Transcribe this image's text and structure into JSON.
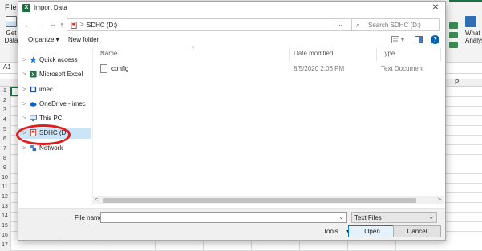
{
  "excel": {
    "file_tab": "File",
    "get_data_label": "Get Data",
    "right_ribbon_label": "What Analys",
    "namebox": "A1",
    "column_p": "P",
    "row_numbers": [
      "1",
      "2",
      "3",
      "4",
      "5",
      "6",
      "7",
      "8",
      "9",
      "10",
      "11",
      "12",
      "13",
      "14",
      "15",
      "16",
      "17"
    ]
  },
  "dialog": {
    "title": "Import Data",
    "close_glyph": "✕",
    "address": {
      "separator": ">",
      "path": "SDHC (D:)",
      "dropdown_glyph": "⌄",
      "refresh_glyph": "↻"
    },
    "search": {
      "icon_glyph": "⌕",
      "placeholder": "Search SDHC (D:)"
    },
    "toolbar": {
      "organize": "Organize ▾",
      "new_folder": "New folder",
      "help_glyph": "?"
    },
    "nav": {
      "back_glyph": "←",
      "forward_glyph": "→",
      "history_glyph": "⌄",
      "up_glyph": "↑",
      "items": [
        {
          "label": "Quick access",
          "icon": "star-icon",
          "chevron": ">"
        },
        {
          "label": "Microsoft Excel",
          "icon": "excel-icon",
          "chevron": ">"
        },
        {
          "label": "imec",
          "icon": "folder-icon",
          "chevron": ">"
        },
        {
          "label": "OneDrive - imec",
          "icon": "cloud-icon",
          "chevron": ">"
        },
        {
          "label": "This PC",
          "icon": "pc-icon",
          "chevron": ">"
        },
        {
          "label": "SDHC (D:)",
          "icon": "drive-icon",
          "chevron": ">"
        },
        {
          "label": "Network",
          "icon": "network-icon",
          "chevron": ">"
        }
      ],
      "selected_index": 5
    },
    "columns": {
      "name": "Name",
      "date_modified": "Date modified",
      "type": "Type"
    },
    "files": [
      {
        "name": "config",
        "date_modified": "8/5/2020 2:06 PM",
        "type": "Text Document"
      }
    ],
    "scroll": {
      "left_glyph": "<",
      "right_glyph": ">"
    },
    "bottom": {
      "file_name_label": "File name:",
      "file_name_value": "",
      "file_name_dd": "⌄",
      "filter_value": "Text Files",
      "filter_dd": "⌄",
      "tools": "Tools",
      "tools_dd": "▼",
      "open": "Open",
      "cancel": "Cancel"
    }
  },
  "colors": {
    "accent": "#0078d7",
    "selection": "#cce4f7",
    "highlight_ellipse": "#e01e1e",
    "excel_green": "#1a7343"
  }
}
